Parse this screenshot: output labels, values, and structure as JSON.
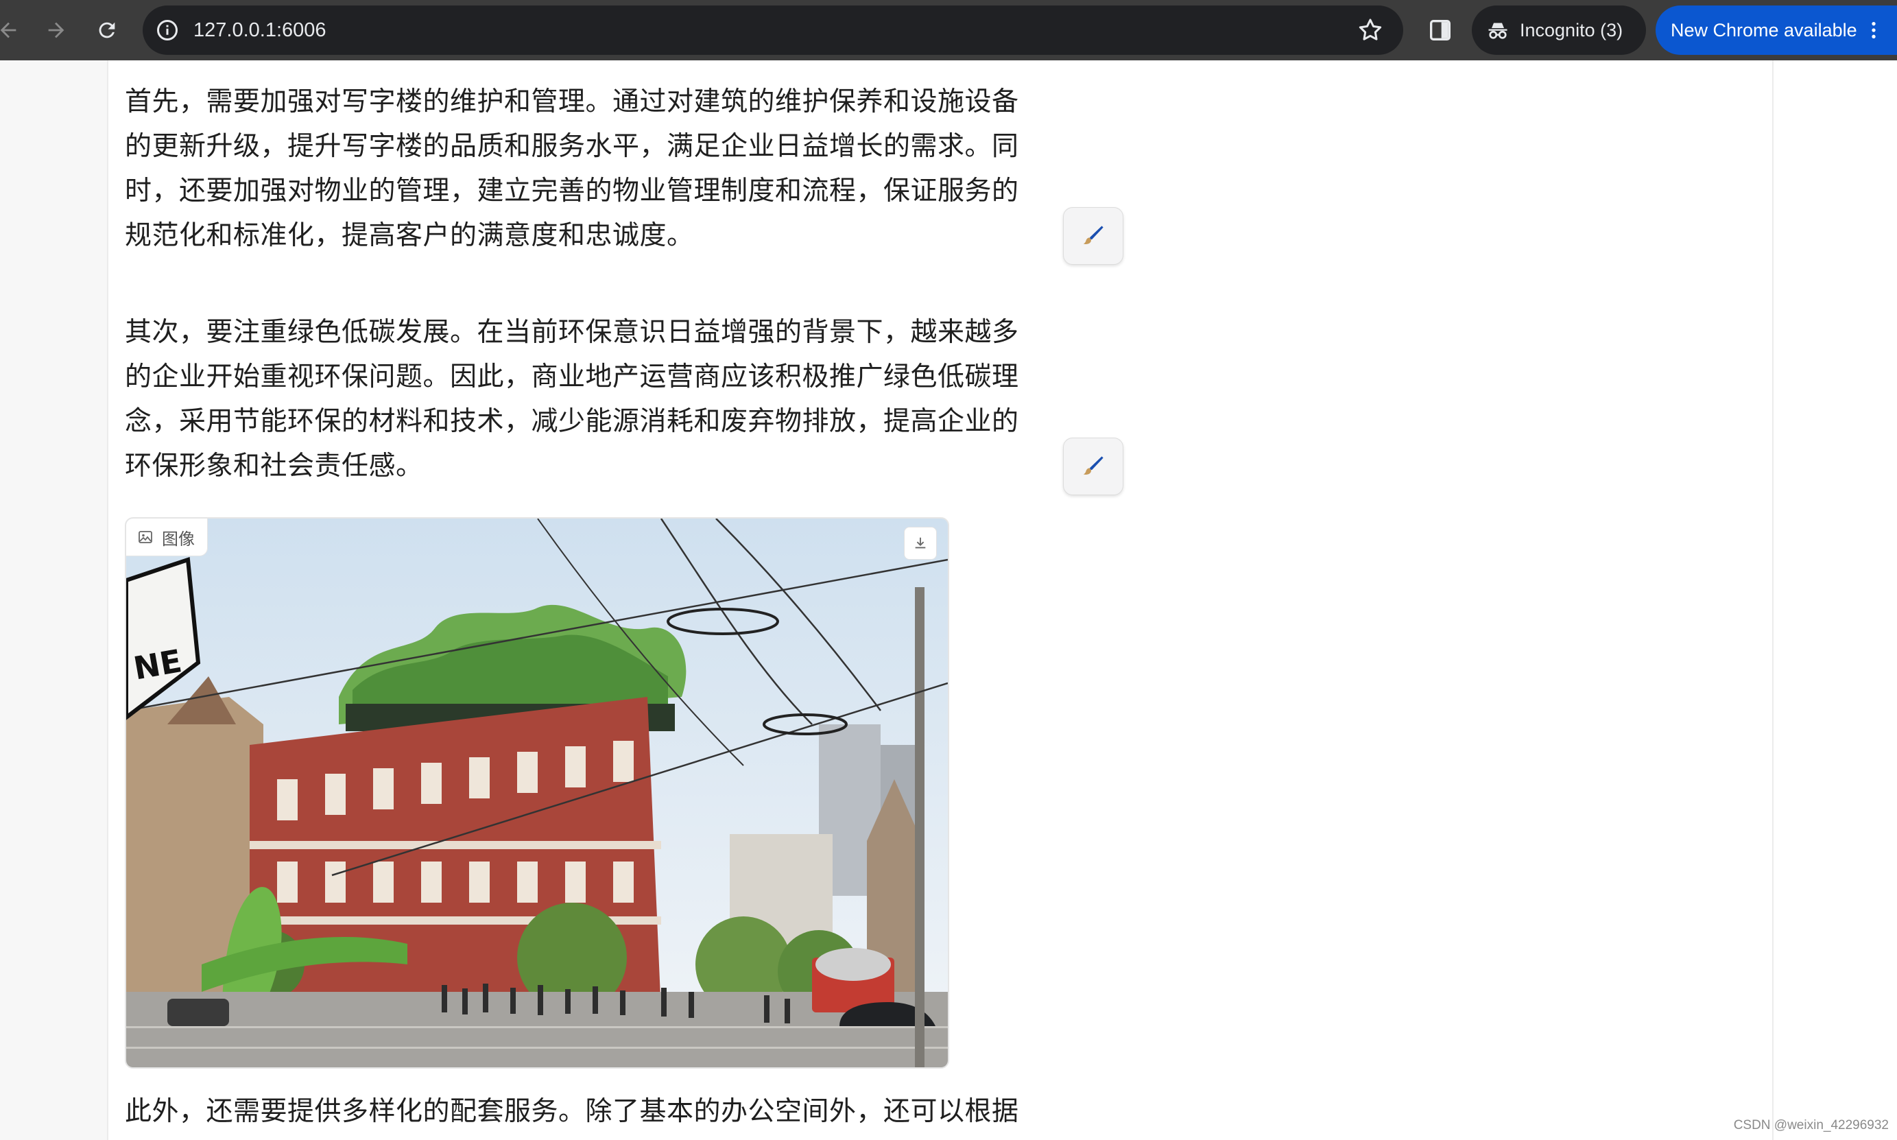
{
  "browser": {
    "url": "127.0.0.1:6006",
    "incognito_label": "Incognito (3)",
    "update_label": "New Chrome available",
    "colors": {
      "toolbar": "#3c3c3c",
      "omnibox": "#202124",
      "update_pill": "#0b57d0"
    }
  },
  "content": {
    "paragraphs": [
      "首先，需要加强对写字楼的维护和管理。通过对建筑的维护保养和设施设备的更新升级，提升写字楼的品质和服务水平，满足企业日益增长的需求。同时，还要加强对物业的管理，建立完善的物业管理制度和流程，保证服务的规范化和标准化，提高客户的满意度和忠诚度。",
      "其次，要注重绿色低碳发展。在当前环保意识日益增强的背景下，越来越多的企业开始重视环保问题。因此，商业地产运营商应该积极推广绿色低碳理念，采用节能环保的材料和技术，减少能源消耗和废弃物排放，提高企业的环保形象和社会责任感。",
      "此外，还需要提供多样化的配套服务。除了基本的办公空间外，还可以根据"
    ],
    "image": {
      "tag_label": "图像",
      "icons": {
        "tag": "image-icon",
        "download": "download-icon"
      }
    },
    "edit_icon": "pencil-icon"
  },
  "watermark": "CSDN @weixin_42296932"
}
